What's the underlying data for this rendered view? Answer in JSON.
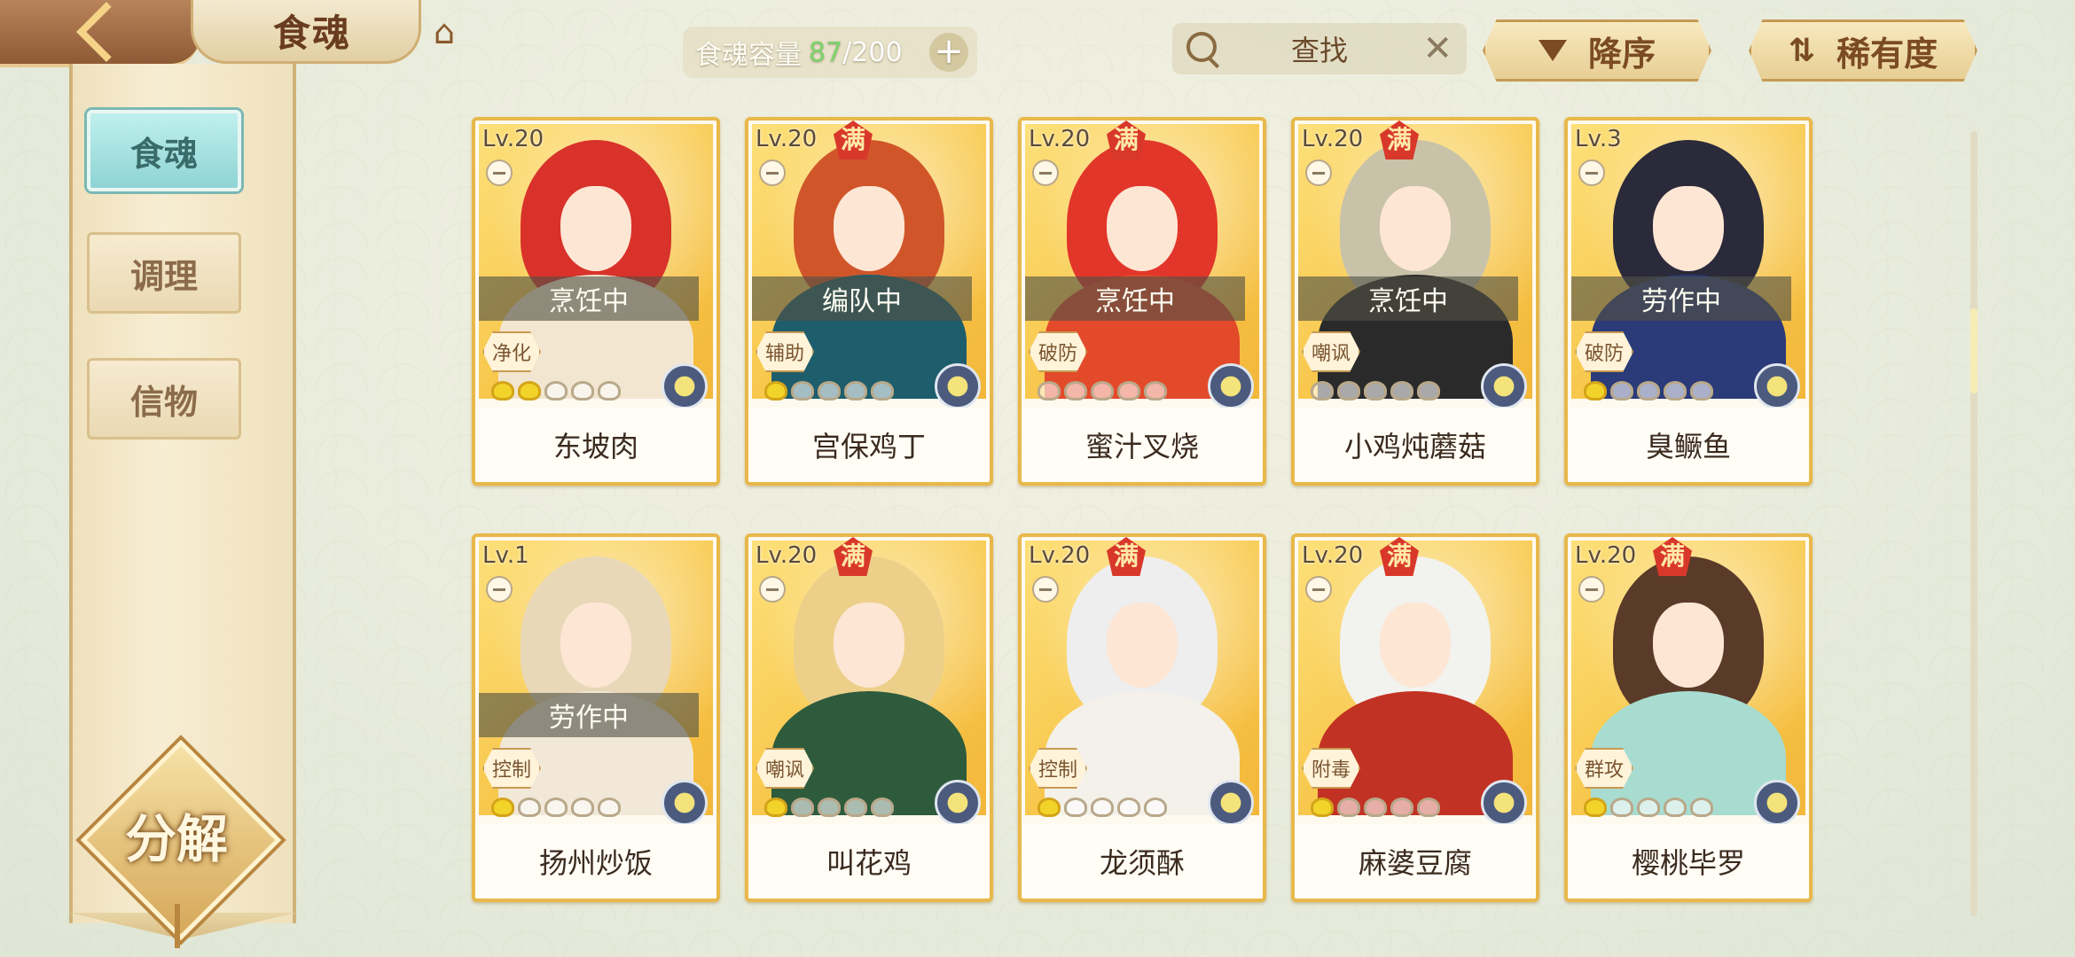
{
  "header": {
    "title": "食魂",
    "capacity": {
      "label": "食魂容量",
      "current": "87",
      "separator": "/",
      "max": "200"
    },
    "search_placeholder": "查找",
    "sort_label": "降序",
    "rarity_label": "稀有度"
  },
  "sidebar": {
    "tabs": [
      {
        "label": "食魂",
        "active": true
      },
      {
        "label": "调理",
        "active": false
      },
      {
        "label": "信物",
        "active": false
      }
    ],
    "decompose_label": "分解"
  },
  "cards": [
    {
      "level": "Lv.20",
      "maxed": false,
      "status": "烹饪中",
      "role": "净化",
      "name": "东坡肉",
      "stars_on": 2,
      "hair": "#d8322a",
      "body": "#f3e6d0"
    },
    {
      "level": "Lv.20",
      "maxed": true,
      "status": "编队中",
      "role": "辅助",
      "name": "宫保鸡丁",
      "stars_on": 1,
      "hair": "#d0562a",
      "body": "#1e5d6b"
    },
    {
      "level": "Lv.20",
      "maxed": true,
      "status": "烹饪中",
      "role": "破防",
      "name": "蜜汁叉烧",
      "stars_on": 0,
      "hair": "#e2362a",
      "body": "#e24a2a"
    },
    {
      "level": "Lv.20",
      "maxed": true,
      "status": "烹饪中",
      "role": "嘲讽",
      "name": "小鸡炖蘑菇",
      "stars_on": 0,
      "hair": "#c8c2a8",
      "body": "#2a2a2a"
    },
    {
      "level": "Lv.3",
      "maxed": false,
      "status": "劳作中",
      "role": "破防",
      "name": "臭鳜鱼",
      "stars_on": 1,
      "hair": "#2a2a3a",
      "body": "#2b3a78"
    },
    {
      "level": "Lv.1",
      "maxed": false,
      "status": "劳作中",
      "role": "控制",
      "name": "扬州炒饭",
      "stars_on": 1,
      "hair": "#e8d8b8",
      "body": "#f1e8d8"
    },
    {
      "level": "Lv.20",
      "maxed": true,
      "status": "",
      "role": "嘲讽",
      "name": "叫花鸡",
      "stars_on": 1,
      "hair": "#ecd08a",
      "body": "#2f5b3d"
    },
    {
      "level": "Lv.20",
      "maxed": true,
      "status": "",
      "role": "控制",
      "name": "龙须酥",
      "stars_on": 1,
      "hair": "#eeeeee",
      "body": "#f4f1ea"
    },
    {
      "level": "Lv.20",
      "maxed": true,
      "status": "",
      "role": "附毒",
      "name": "麻婆豆腐",
      "stars_on": 1,
      "hair": "#f2f2ee",
      "body": "#c23224"
    },
    {
      "level": "Lv.20",
      "maxed": true,
      "status": "",
      "role": "群攻",
      "name": "樱桃毕罗",
      "stars_on": 1,
      "hair": "#5a3a28",
      "body": "#a8dcd0"
    }
  ]
}
